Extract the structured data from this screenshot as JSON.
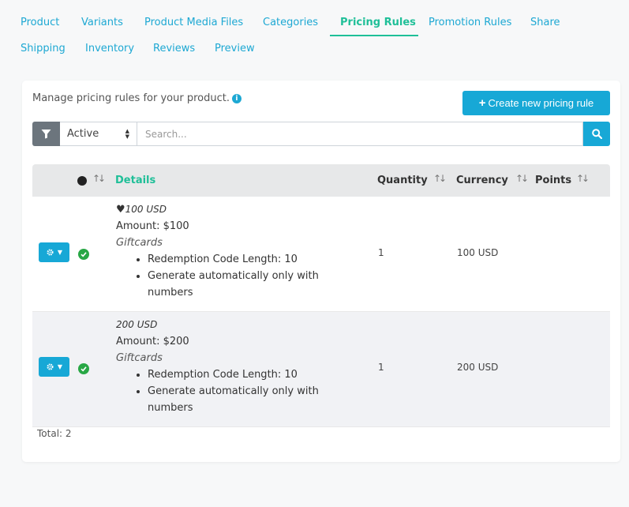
{
  "tabs": [
    {
      "label": "Product"
    },
    {
      "label": "Variants"
    },
    {
      "label": "Product Media Files"
    },
    {
      "label": "Categories"
    },
    {
      "label": "Pricing Rules",
      "active": true
    },
    {
      "label": "Promotion Rules"
    },
    {
      "label": "Share"
    },
    {
      "label": "Shipping"
    },
    {
      "label": "Inventory"
    },
    {
      "label": "Reviews"
    },
    {
      "label": "Preview"
    }
  ],
  "intro": "Manage pricing rules for your product.",
  "create_button": "Create new pricing rule",
  "filter": {
    "status_value": "Active",
    "search_placeholder": "Search..."
  },
  "columns": {
    "details": "Details",
    "quantity": "Quantity",
    "currency": "Currency",
    "points": "Points"
  },
  "rows": [
    {
      "title": "100 USD",
      "favorite": true,
      "amount": "Amount: $100",
      "category": "Giftcards",
      "bullets": [
        "Redemption Code Length: 10",
        "Generate automatically only with numbers"
      ],
      "quantity": "1",
      "currency": "100 USD",
      "points": ""
    },
    {
      "title": "200 USD",
      "favorite": false,
      "amount": "Amount: $200",
      "category": "Giftcards",
      "bullets": [
        "Redemption Code Length: 10",
        "Generate automatically only with numbers"
      ],
      "quantity": "1",
      "currency": "200 USD",
      "points": ""
    }
  ],
  "total": "Total: 2",
  "colors": {
    "accent": "#17a8d6",
    "active_tab": "#1fbf98",
    "success": "#28a745"
  }
}
